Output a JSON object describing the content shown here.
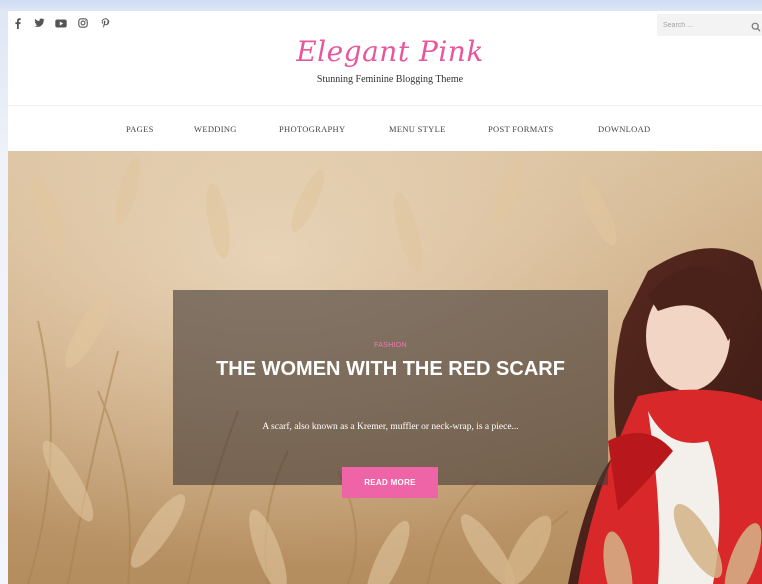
{
  "site": {
    "title": "Elegant Pink",
    "tagline": "Stunning Feminine Blogging Theme"
  },
  "social_icons": [
    "facebook-icon",
    "twitter-icon",
    "youtube-icon",
    "instagram-icon",
    "pinterest-icon"
  ],
  "search": {
    "placeholder": "Search ..."
  },
  "nav": {
    "items": [
      "PAGES",
      "WEDDING",
      "PHOTOGRAPHY",
      "MENU STYLE",
      "POST FORMATS",
      "DOWNLOAD"
    ]
  },
  "hero": {
    "category": "FASHION",
    "title": "THE WOMEN WITH THE RED SCARF",
    "excerpt": "A scarf, also known as a Kremer, muffler or neck-wrap, is a piece...",
    "button_label": "READ MORE"
  },
  "colors": {
    "brand_pink": "#e8579d",
    "button_pink": "#ef64a6",
    "category_pink": "#f176b1"
  }
}
